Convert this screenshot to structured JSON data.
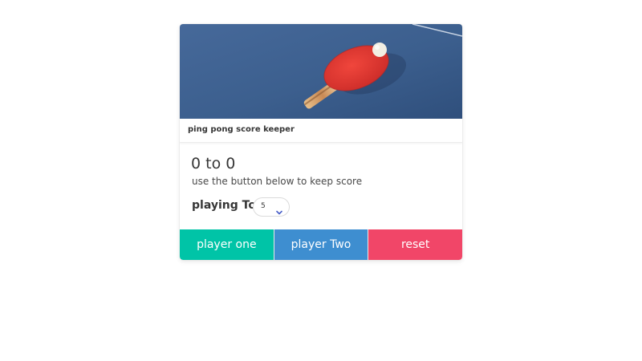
{
  "card": {
    "image_alt": "ping pong paddle on table",
    "header_title": "ping pong score keeper"
  },
  "score": {
    "text": "0 to 0",
    "subtitle": "use the button below to keep score"
  },
  "playing_to": {
    "label": "playing To",
    "selected_value": "5"
  },
  "buttons": {
    "player_one": "player one",
    "player_two": "player Two",
    "reset": "reset"
  },
  "colors": {
    "player_one": "#00c4a7",
    "player_two": "#3e8ed0",
    "reset": "#f14668",
    "table_blue": "#3b5f8f",
    "paddle_red": "#e23a34"
  },
  "icons": {
    "select_arrow": "chevron-down-icon"
  }
}
